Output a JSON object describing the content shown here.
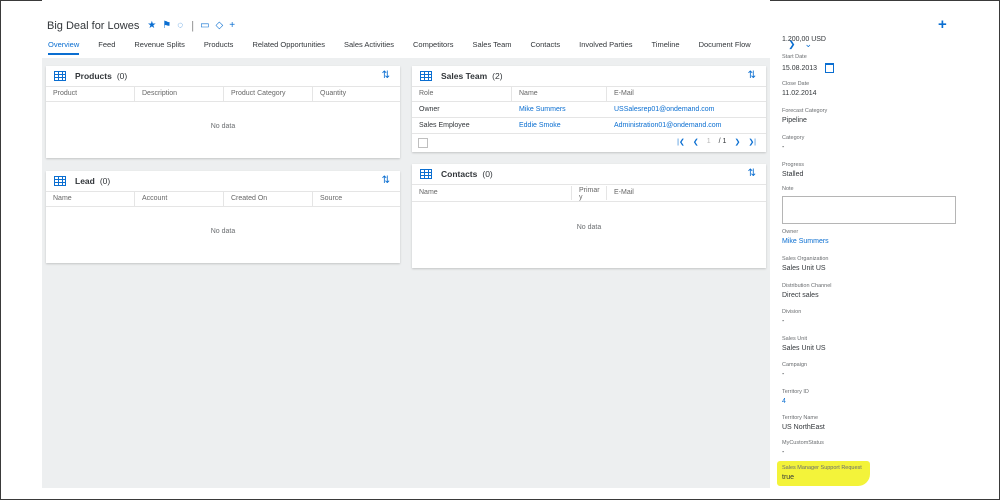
{
  "header": {
    "title": "Big Deal for Lowes",
    "icons": [
      "star-icon",
      "flag-icon",
      "rss-icon",
      "comment-icon",
      "tag-icon",
      "plus-icon"
    ]
  },
  "tabs": [
    "Overview",
    "Feed",
    "Revenue Splits",
    "Products",
    "Related Opportunities",
    "Sales Activities",
    "Competitors",
    "Sales Team",
    "Contacts",
    "Involved Parties",
    "Timeline",
    "Document Flow"
  ],
  "products_card": {
    "title": "Products",
    "count": "(0)",
    "columns": [
      "Product",
      "Description",
      "Product Category",
      "Quantity"
    ],
    "empty": "No data"
  },
  "lead_card": {
    "title": "Lead",
    "count": "(0)",
    "columns": [
      "Name",
      "Account",
      "Created On",
      "Source"
    ],
    "empty": "No data"
  },
  "sales_team_card": {
    "title": "Sales Team",
    "count": "(2)",
    "columns": [
      "Role",
      "Name",
      "E-Mail"
    ],
    "rows": [
      {
        "role": "Owner",
        "name": "Mike Summers",
        "email": "USSalesrep01@ondemand.com"
      },
      {
        "role": "Sales Employee",
        "name": "Eddie Smoke",
        "email": "Administration01@ondemand.com"
      }
    ],
    "pager": {
      "page": "1",
      "total": "/ 1"
    }
  },
  "contacts_card": {
    "title": "Contacts",
    "count": "(0)",
    "columns": [
      "Name",
      "Primar\ny",
      "E-Mail"
    ],
    "empty": "No data"
  },
  "side_panel": {
    "amount": "1.200,00 USD",
    "fields": [
      {
        "label": "Start Date",
        "value": "15.08.2013"
      },
      {
        "label": "Close Date",
        "value": "11.02.2014"
      },
      {
        "label": "Forecast Category",
        "value": "Pipeline"
      },
      {
        "label": "Category",
        "value": "-"
      },
      {
        "label": "Progress",
        "value": "Stalled"
      },
      {
        "label": "Note",
        "value": ""
      },
      {
        "label": "Owner",
        "value": "Mike Summers"
      },
      {
        "label": "Sales Organization",
        "value": "Sales Unit US"
      },
      {
        "label": "Distribution Channel",
        "value": "Direct sales"
      },
      {
        "label": "Division",
        "value": "-"
      },
      {
        "label": "Sales Unit",
        "value": "Sales Unit US"
      },
      {
        "label": "Campaign",
        "value": "-"
      },
      {
        "label": "Territory ID",
        "value": "4"
      },
      {
        "label": "Territory Name",
        "value": "US NorthEast"
      },
      {
        "label": "MyCustomStatus",
        "value": "-"
      },
      {
        "label": "Sales Manager Support Request",
        "value": "true"
      }
    ]
  },
  "colors": {
    "accent": "#0a6ed1",
    "highlight": "#f3f33a",
    "content_bg": "#edeff0"
  }
}
